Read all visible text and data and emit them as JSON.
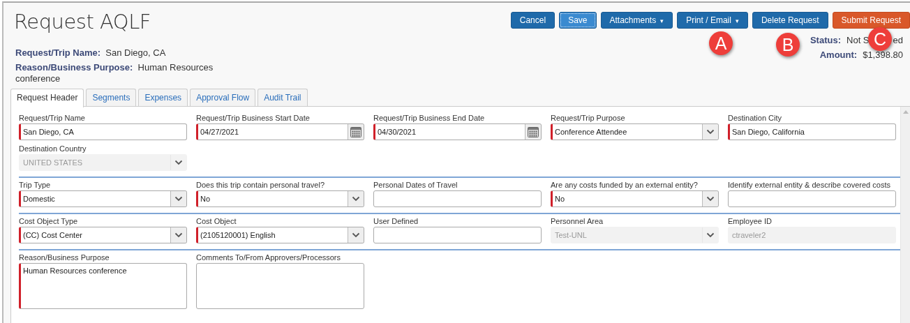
{
  "title": "Request AQLF",
  "summary": [
    {
      "label": "Request/Trip Name:",
      "value": "San Diego, CA"
    },
    {
      "label": "Reason/Business Purpose:",
      "value": "Human Resources conference"
    }
  ],
  "buttons": [
    {
      "label": "Cancel",
      "kind": "primary"
    },
    {
      "label": "Save",
      "kind": "focused"
    },
    {
      "label": "Attachments",
      "kind": "primary",
      "caret": "▾"
    },
    {
      "label": "Print / Email",
      "kind": "primary",
      "caret": "▾"
    },
    {
      "label": "Delete Request",
      "kind": "primary"
    },
    {
      "label": "Submit Request",
      "kind": "danger"
    }
  ],
  "status": {
    "label": "Status:",
    "value_parts": [
      "Not S",
      "ed"
    ]
  },
  "amount": {
    "label": "Amount:",
    "value": "$1,398.80"
  },
  "callouts": [
    "A",
    "B",
    "C"
  ],
  "tabs": [
    {
      "label": "Request Header",
      "selected": true
    },
    {
      "label": "Segments",
      "selected": false
    },
    {
      "label": "Expenses",
      "selected": false
    },
    {
      "label": "Approval Flow",
      "selected": false
    },
    {
      "label": "Audit Trail",
      "selected": false
    }
  ],
  "sections": [
    {
      "fields": [
        {
          "label": "Request/Trip Name",
          "kind": "text",
          "value": "San Diego, CA",
          "required": true,
          "disabled": false
        },
        {
          "label": "Request/Trip Business Start Date",
          "kind": "date",
          "value": "04/27/2021",
          "required": true,
          "disabled": false
        },
        {
          "label": "Request/Trip Business End Date",
          "kind": "date",
          "value": "04/30/2021",
          "required": true,
          "disabled": false
        },
        {
          "label": "Request/Trip Purpose",
          "kind": "select",
          "value": "Conference Attendee",
          "required": true,
          "disabled": false
        },
        {
          "label": "Destination City",
          "kind": "text",
          "value": "San Diego, California",
          "required": true,
          "disabled": false
        },
        {
          "label": "Destination Country",
          "kind": "select",
          "value": "UNITED STATES",
          "required": false,
          "disabled": true
        }
      ]
    },
    {
      "fields": [
        {
          "label": "Trip Type",
          "kind": "select",
          "value": "Domestic",
          "required": true,
          "disabled": false
        },
        {
          "label": "Does this trip contain personal travel?",
          "kind": "select",
          "value": "No",
          "required": true,
          "disabled": false
        },
        {
          "label": "Personal Dates of Travel",
          "kind": "text",
          "required": false,
          "disabled": false
        },
        {
          "label": "Are any costs funded by an external entity?",
          "kind": "select",
          "value": "No",
          "required": true,
          "disabled": false
        },
        {
          "label": "Identify external entity & describe covered costs",
          "kind": "text",
          "required": false,
          "disabled": false
        }
      ]
    },
    {
      "fields": [
        {
          "label": "Cost Object Type",
          "kind": "select",
          "value": "(CC) Cost Center",
          "required": true,
          "disabled": false
        },
        {
          "label": "Cost Object",
          "kind": "select",
          "value": "(2105120001) English",
          "required": true,
          "disabled": false
        },
        {
          "label": "User Defined",
          "kind": "text",
          "required": false,
          "disabled": false
        },
        {
          "label": "Personnel Area",
          "kind": "select",
          "value": "Test-UNL",
          "required": false,
          "disabled": true
        },
        {
          "label": "Employee ID",
          "kind": "text",
          "value": "ctraveler2",
          "required": false,
          "disabled": true
        }
      ]
    },
    {
      "fields": [
        {
          "label": "Reason/Business Purpose",
          "kind": "textarea",
          "value": "Human Resources conference",
          "required": true,
          "disabled": false
        },
        {
          "label": "Comments To/From Approvers/Processors",
          "kind": "textarea",
          "required": false,
          "disabled": false
        }
      ]
    }
  ]
}
